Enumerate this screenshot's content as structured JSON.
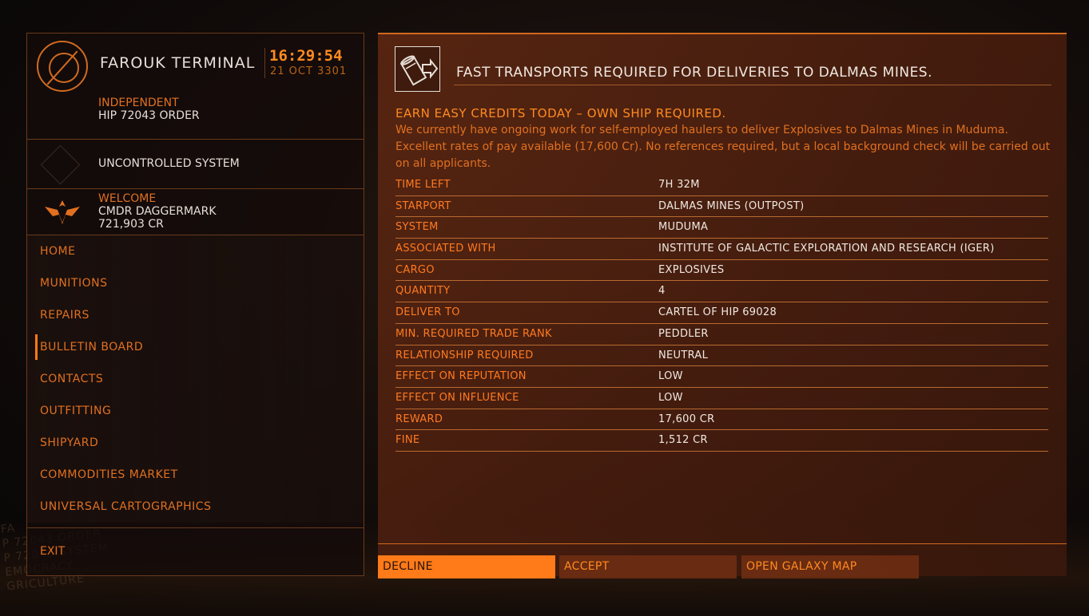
{
  "station": {
    "name": "FAROUK TERMINAL",
    "time": "16:29:54",
    "date": "21 OCT 3301",
    "faction_state": "INDEPENDENT",
    "faction_name": "HIP 72043 ORDER"
  },
  "system": {
    "status": "UNCONTROLLED SYSTEM"
  },
  "commander": {
    "welcome": "WELCOME",
    "name": "CMDR DAGGERMARK",
    "credits": "721,903 CR"
  },
  "nav": {
    "items": [
      {
        "label": "HOME"
      },
      {
        "label": "MUNITIONS"
      },
      {
        "label": "REPAIRS"
      },
      {
        "label": "BULLETIN BOARD"
      },
      {
        "label": "CONTACTS"
      },
      {
        "label": "OUTFITTING"
      },
      {
        "label": "SHIPYARD"
      },
      {
        "label": "COMMODITIES MARKET"
      },
      {
        "label": "UNIVERSAL CARTOGRAPHICS"
      }
    ],
    "active_index": 3,
    "exit_label": "EXIT"
  },
  "background_text": [
    "FA",
    "P 72043 ORDER",
    "P 72043 SYSTEM",
    "EMOCRACY",
    "GRICULTURE"
  ],
  "mission": {
    "title": "FAST TRANSPORTS REQUIRED FOR DELIVERIES TO DALMAS MINES.",
    "headline": "EARN EASY CREDITS TODAY – OWN SHIP REQUIRED.",
    "description": "We currently have ongoing work for self-employed haulers to deliver Explosives to Dalmas Mines in Muduma. Excellent rates of pay available (17,600 Cr). No references required, but a local background check will be carried out on all applicants.",
    "details": [
      {
        "label": "TIME LEFT",
        "value": "7H 32M"
      },
      {
        "label": "STARPORT",
        "value": "DALMAS MINES (OUTPOST)"
      },
      {
        "label": "SYSTEM",
        "value": "MUDUMA"
      },
      {
        "label": "ASSOCIATED WITH",
        "value": "INSTITUTE OF GALACTIC EXPLORATION AND RESEARCH (IGER)"
      },
      {
        "label": "CARGO",
        "value": "EXPLOSIVES"
      },
      {
        "label": "QUANTITY",
        "value": "4"
      },
      {
        "label": "DELIVER TO",
        "value": "CARTEL OF HIP 69028"
      },
      {
        "label": "MIN. REQUIRED TRADE RANK",
        "value": "PEDDLER"
      },
      {
        "label": "RELATIONSHIP REQUIRED",
        "value": "NEUTRAL"
      },
      {
        "label": "EFFECT ON REPUTATION",
        "value": "LOW"
      },
      {
        "label": "EFFECT ON INFLUENCE",
        "value": "LOW"
      },
      {
        "label": "REWARD",
        "value": "17,600 CR"
      },
      {
        "label": "FINE",
        "value": "1,512 CR"
      }
    ]
  },
  "actions": {
    "decline": "DECLINE",
    "accept": "ACCEPT",
    "galaxy_map": "OPEN GALAXY MAP"
  },
  "colors": {
    "accent": "#ff7a18",
    "accent_text": "#e07020",
    "panel_bg": "#5f2812",
    "text_primary": "#f0e8e0"
  }
}
